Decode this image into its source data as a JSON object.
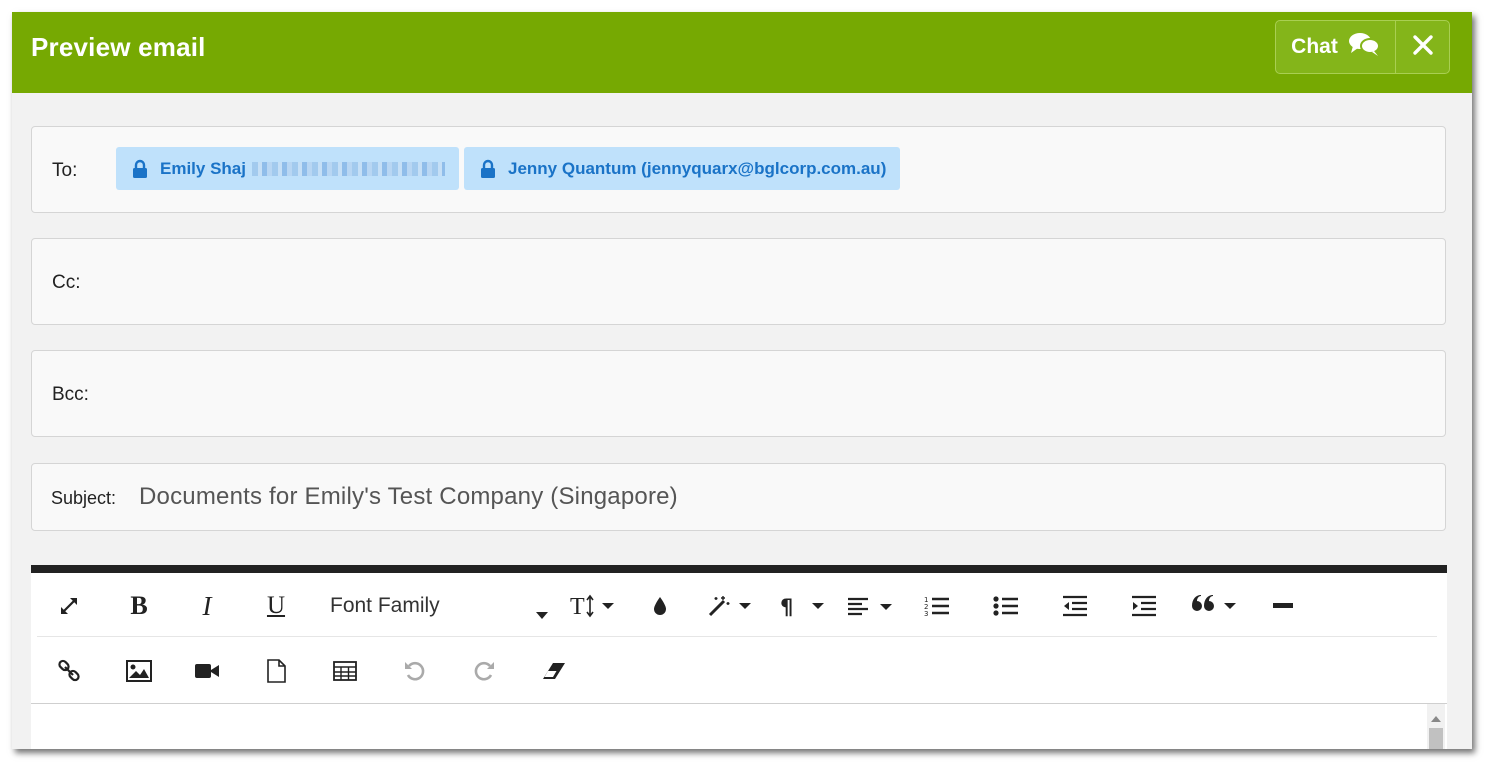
{
  "dialog": {
    "title": "Preview email",
    "chat_label": "Chat",
    "colors": {
      "header": "#76a902",
      "chip_bg": "#bfe1fb",
      "chip_text": "#1a73c7"
    }
  },
  "to": {
    "label": "To:",
    "recipients": [
      {
        "name": "Emily Shaj",
        "email_redacted": true
      },
      {
        "display": "Jenny Quantum (jennyquarx@bglcorp.com.au)"
      }
    ]
  },
  "cc": {
    "label": "Cc:"
  },
  "bcc": {
    "label": "Bcc:"
  },
  "subject": {
    "label": "Subject:",
    "value": "Documents for Emily's Test Company (Singapore)"
  },
  "toolbar": {
    "font_family_label": "Font Family",
    "row1_icons": [
      "expand-icon",
      "bold-icon",
      "italic-icon",
      "underline-icon",
      "font-family-dropdown",
      "font-size-icon",
      "color-drop-icon",
      "magic-wand-icon",
      "paragraph-icon",
      "align-left-icon",
      "ordered-list-icon",
      "unordered-list-icon",
      "outdent-icon",
      "indent-icon",
      "quote-icon",
      "horizontal-rule-icon"
    ],
    "row2_icons": [
      "link-icon",
      "image-icon",
      "video-icon",
      "file-icon",
      "table-icon",
      "undo-icon",
      "redo-icon",
      "eraser-icon"
    ]
  }
}
